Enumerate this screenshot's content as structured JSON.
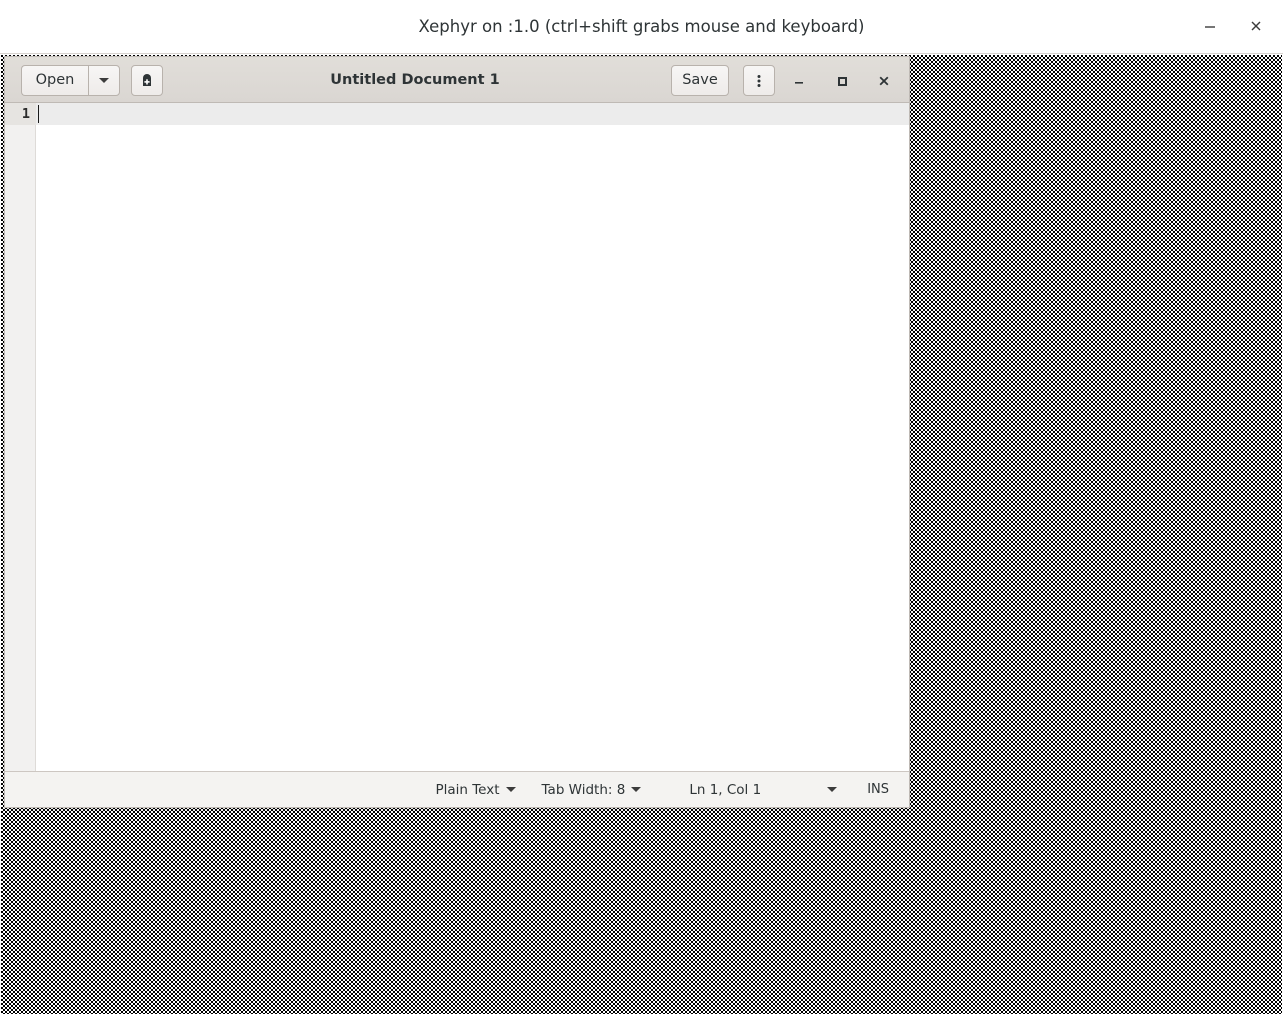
{
  "xephyr": {
    "title": "Xephyr on :1.0 (ctrl+shift grabs mouse and keyboard)",
    "controls": {
      "minimize": "minimize-icon",
      "close": "close-icon"
    }
  },
  "gedit": {
    "title": "Untitled Document 1",
    "toolbar": {
      "open_label": "Open",
      "open_dropdown_icon": "chevron-down-icon",
      "new_document_icon": "new-document-icon",
      "save_label": "Save",
      "menu_icon": "kebab-menu-icon",
      "minimize_icon": "minimize-icon",
      "maximize_icon": "maximize-icon",
      "close_icon": "close-icon"
    },
    "editor": {
      "line_numbers": [
        "1"
      ],
      "content": ""
    },
    "statusbar": {
      "language": "Plain Text",
      "language_dropdown_icon": "chevron-down-icon",
      "tab_width": "Tab Width: 8",
      "tab_width_dropdown_icon": "chevron-down-icon",
      "position": "Ln 1, Col 1",
      "position_dropdown_icon": "chevron-down-icon",
      "insert_mode": "INS"
    }
  },
  "colors": {
    "headerbar_bg": "#ddd9d5",
    "window_bg": "#f6f5f4",
    "editor_bg": "#ffffff",
    "gutter_bg": "#f2f1f0",
    "current_line": "#ececec",
    "text": "#2e3436",
    "border": "#bfbab5",
    "root_black": "#000000",
    "root_white": "#ffffff"
  }
}
